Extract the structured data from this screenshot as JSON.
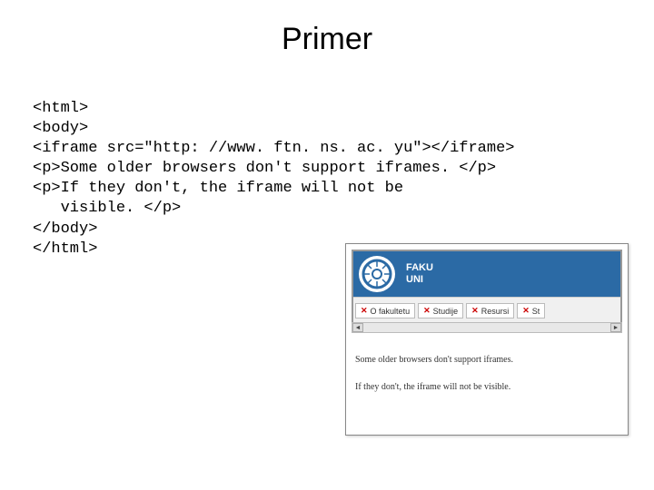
{
  "title": "Primer",
  "code": {
    "l1": "<html>",
    "l2": "<body>",
    "l3": "<iframe src=\"http: //www. ftn. ns. ac. yu\"></iframe>",
    "l4": "<p>Some older browsers don't support iframes. </p>",
    "l5": "<p>If they don't, the iframe will not be",
    "l6": "   visible. </p>",
    "l7": "</body>",
    "l8": "</html>"
  },
  "preview": {
    "header": {
      "line1": "FAKU",
      "line2": "UNI"
    },
    "nav": [
      "O fakultetu",
      "Studije",
      "Resursi",
      "St"
    ],
    "text1": "Some older browsers don't support iframes.",
    "text2": "If they don't, the iframe will not be visible."
  }
}
